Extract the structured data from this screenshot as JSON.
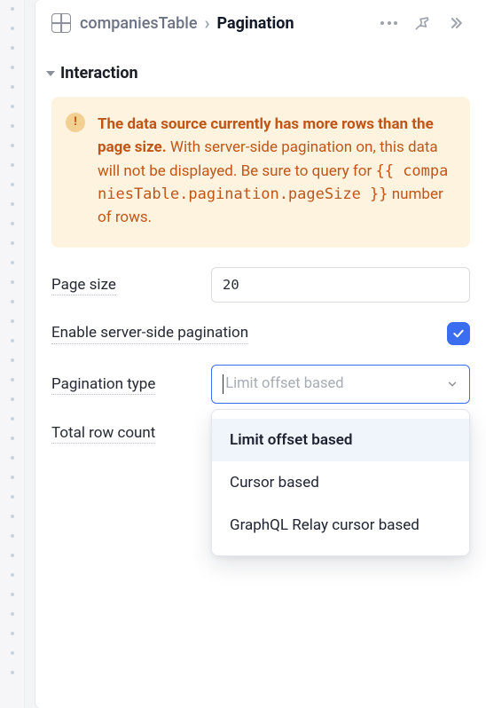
{
  "header": {
    "breadcrumb_root": "companiesTable",
    "breadcrumb_separator": "›",
    "breadcrumb_current": "Pagination"
  },
  "section": {
    "title": "Interaction"
  },
  "alert": {
    "bold_text": "The data source currently has more rows than the page size.",
    "body_prefix": " With server-side pagination on, this data will not be displayed. Be sure to query for ",
    "code": "{{ companiesTable.pagination.pageSize }}",
    "body_suffix": " number of rows."
  },
  "form": {
    "page_size": {
      "label": "Page size",
      "value": "20"
    },
    "server_side": {
      "label": "Enable server-side pagination",
      "checked": true
    },
    "pagination_type": {
      "label": "Pagination type",
      "placeholder": "Limit offset based",
      "options": [
        "Limit offset based",
        "Cursor based",
        "GraphQL Relay cursor based"
      ],
      "selected_index": 0
    },
    "total_row_count": {
      "label": "Total row count"
    }
  }
}
